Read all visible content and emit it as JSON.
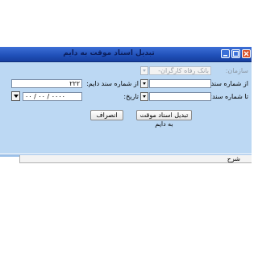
{
  "window": {
    "title": "تبدیل اسناد موقت به دایم"
  },
  "form": {
    "organization_label": "سازمان:",
    "organization_value": "بانک رفاه کارگران- اداره",
    "from_doc_label": "از شماره سند:",
    "from_doc_value": "",
    "to_doc_label": "تا شماره سند:",
    "to_doc_value": "",
    "from_perm_doc_label": "از شماره سند دایم:",
    "from_perm_doc_value": "۲۲۲",
    "date_label": "تاریخ:",
    "date_value": "۰۰ / ۰۰ / ۰۰۰۰"
  },
  "buttons": {
    "convert_label": "تبدیل اسناد موقت به دایم",
    "cancel_label": "انصراف"
  },
  "grid": {
    "columns": [
      "شرح"
    ]
  },
  "colors": {
    "titlebar": "#1f4fb8",
    "panel": "#bcd8f3"
  }
}
